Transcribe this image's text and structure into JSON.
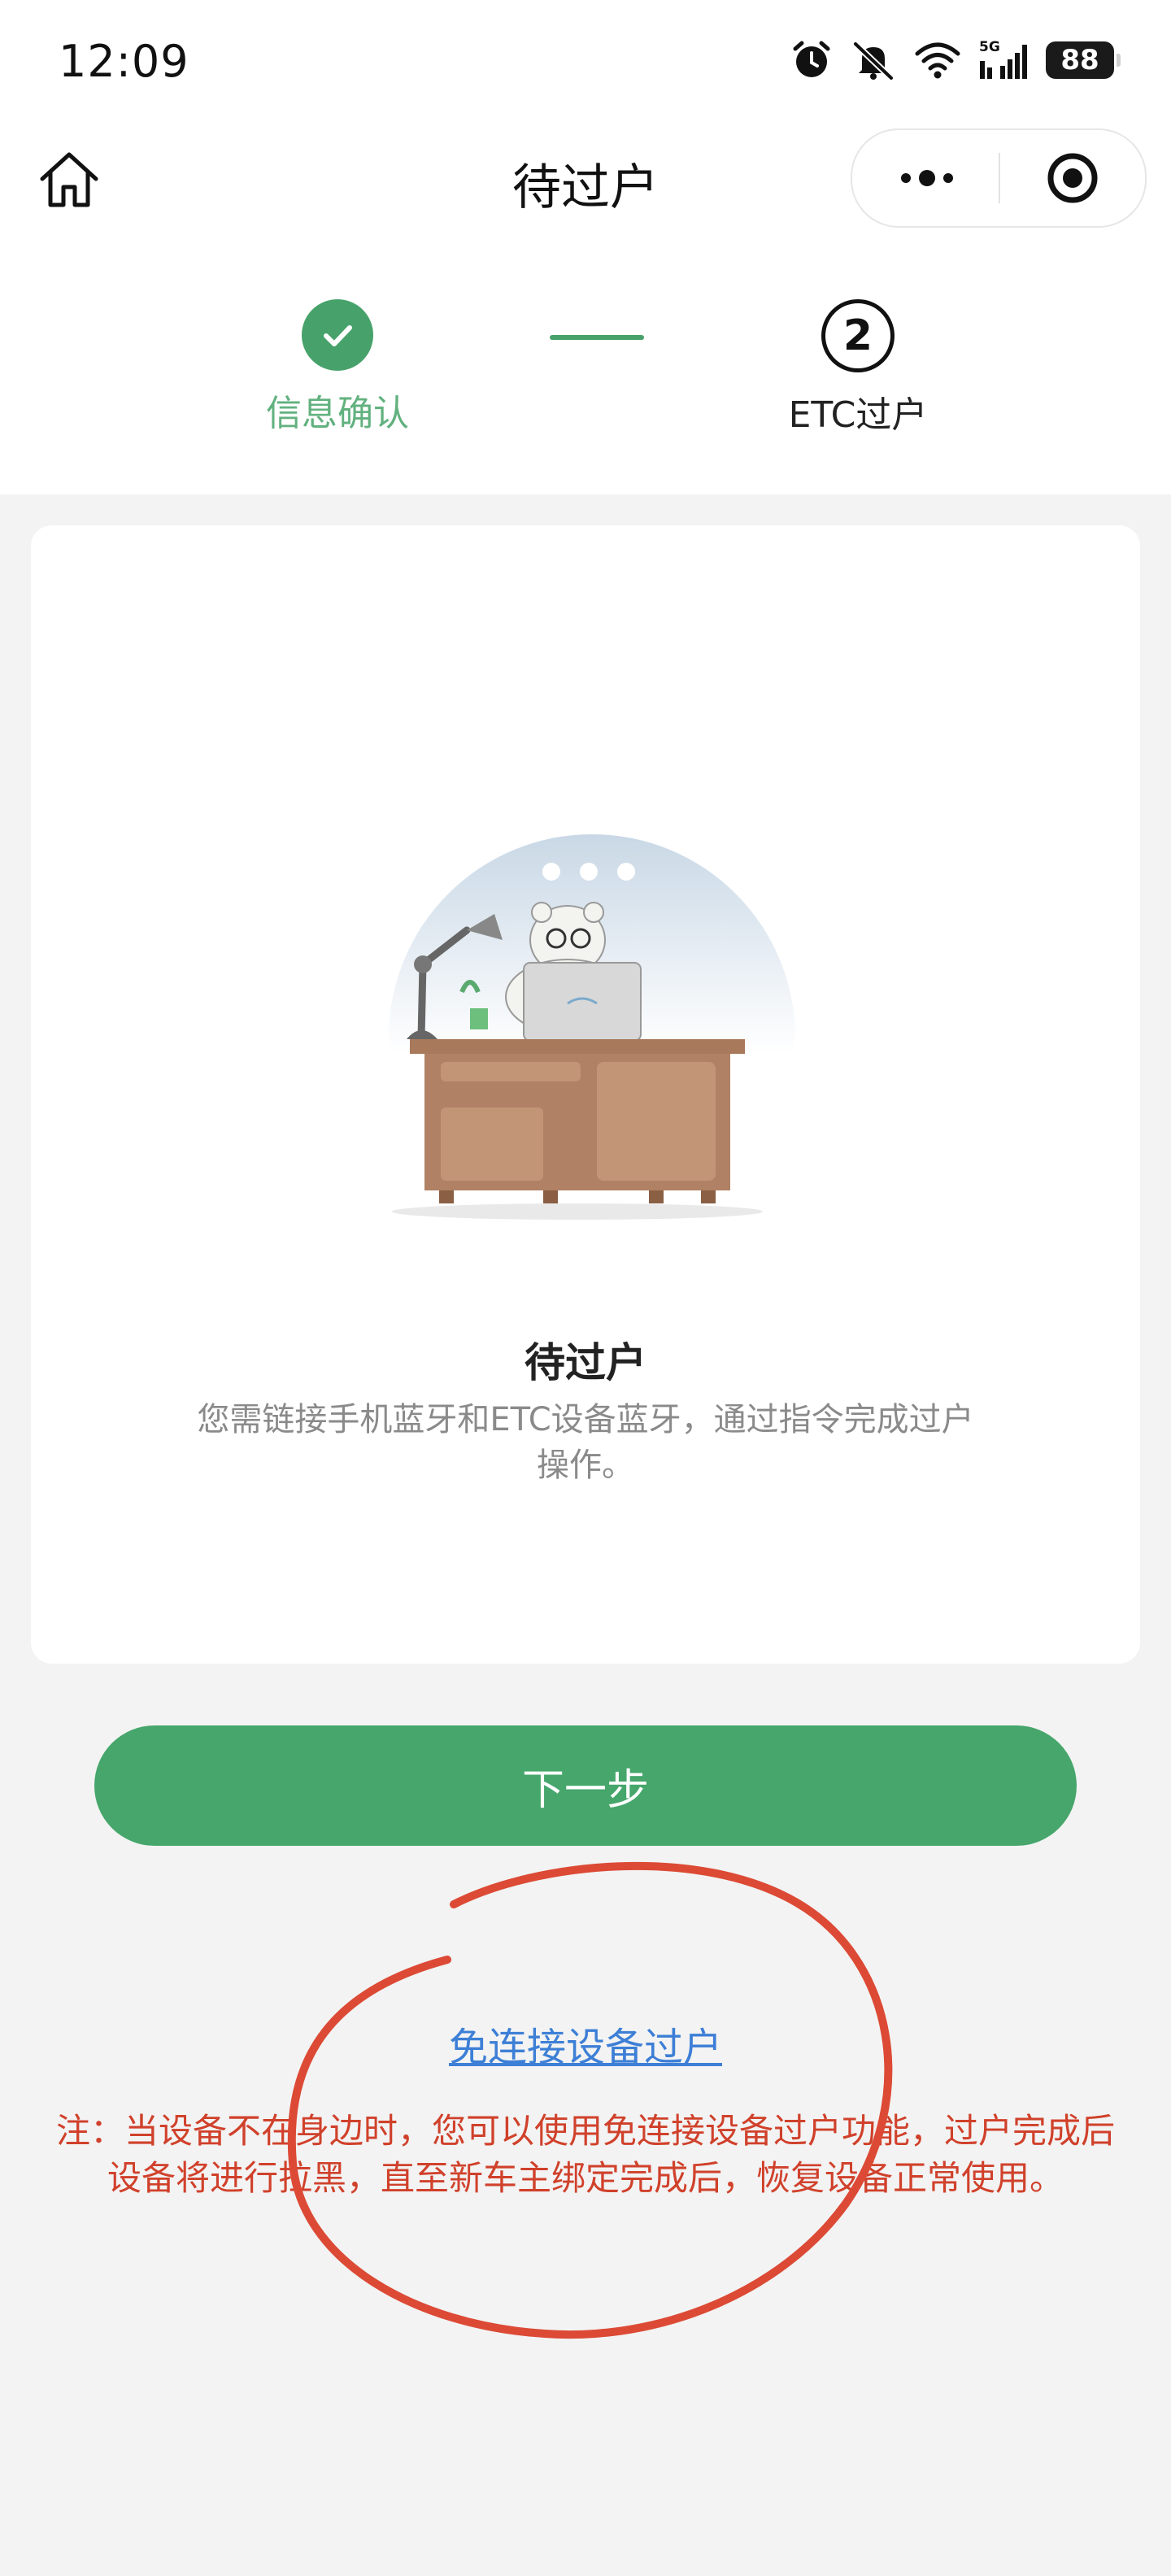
{
  "status_bar": {
    "time": "12:09",
    "network": "5G",
    "battery": "88",
    "icons": [
      "alarm-icon",
      "mute-icon",
      "wifi-icon",
      "signal-icon",
      "battery-icon"
    ]
  },
  "nav": {
    "title": "待过户",
    "home_icon": "home-icon",
    "more_icon": "more-icon",
    "close_icon": "target-icon"
  },
  "steps": [
    {
      "label": "信息确认",
      "state": "done"
    },
    {
      "label": "ETC过户",
      "number": "2",
      "state": "current"
    }
  ],
  "card": {
    "title": "待过户",
    "description": "您需链接手机蓝牙和ETC设备蓝牙，通过指令完成过户操作。"
  },
  "next_button": "下一步",
  "alt_link": "免连接设备过户",
  "note": "注：当设备不在身边时，您可以使用免连接设备过户功能，过户完成后设备将进行拉黑，直至新车主绑定完成后，恢复设备正常使用。",
  "colors": {
    "primary_green": "#46a66b",
    "step_done_text": "#62b17f",
    "link_blue": "#3d7fd6",
    "note_red": "#d0412b",
    "annotation_red": "#dc4a35"
  }
}
